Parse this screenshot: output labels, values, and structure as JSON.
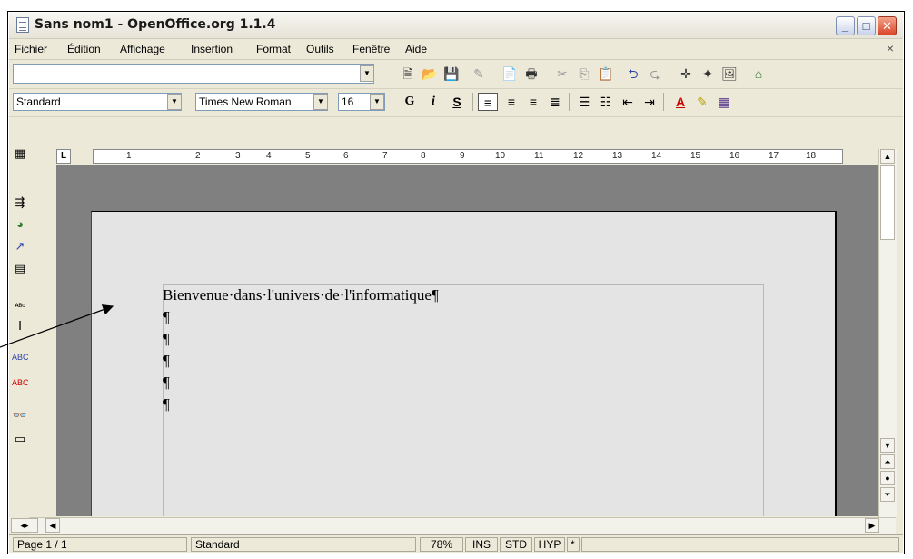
{
  "window": {
    "title": "Sans nom1 - OpenOffice.org 1.1.4"
  },
  "menu": [
    "Fichier",
    "Édition",
    "Affichage",
    "Insertion",
    "Format",
    "Outils",
    "Fenêtre",
    "Aide"
  ],
  "menu_close": "×",
  "format_toolbar": {
    "style": "Standard",
    "font": "Times New Roman",
    "size": "16",
    "bold": "G",
    "italic": "i",
    "underline": "S"
  },
  "ruler": {
    "marks": [
      "1",
      "2",
      "3",
      "4",
      "5",
      "6",
      "7",
      "8",
      "9",
      "10",
      "11",
      "12",
      "13",
      "14",
      "15",
      "16",
      "17",
      "18"
    ],
    "corner": "L"
  },
  "document": {
    "lines": [
      "Bienvenue·dans·l'univers·de·l'informatique¶",
      "¶",
      "¶",
      "¶",
      "¶",
      "¶"
    ]
  },
  "status": {
    "page": "Page 1 / 1",
    "style": "Standard",
    "zoom": "78%",
    "ins": "INS",
    "std": "STD",
    "hyp": "HYP",
    "modified": "*"
  }
}
